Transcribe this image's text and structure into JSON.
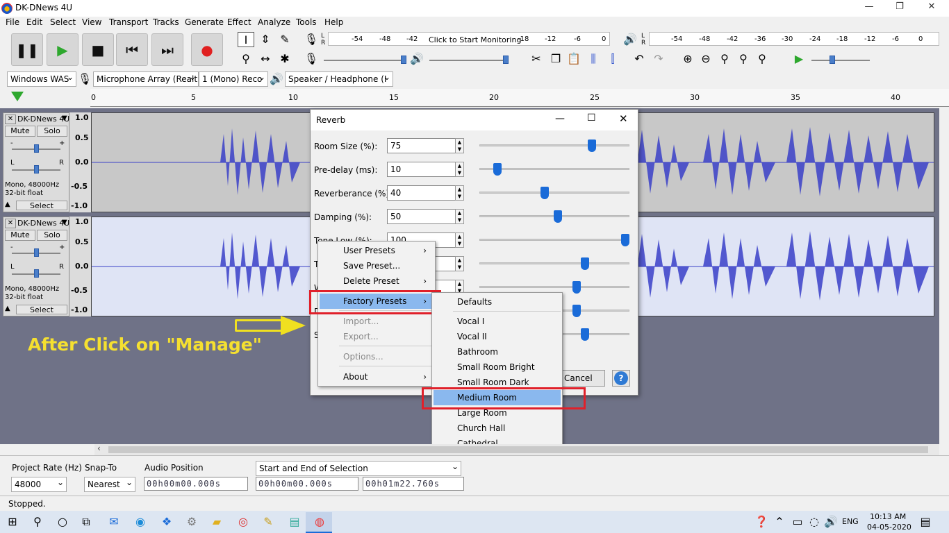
{
  "window": {
    "title": "DK-DNews 4U"
  },
  "menubar": [
    "File",
    "Edit",
    "Select",
    "View",
    "Transport",
    "Tracks",
    "Generate",
    "Effect",
    "Analyze",
    "Tools",
    "Help"
  ],
  "meters": {
    "record_ticks": [
      "-54",
      "-48",
      "-42",
      "-18",
      "-12",
      "-6",
      "0"
    ],
    "record_label": "Click to Start Monitoring",
    "play_ticks": [
      "-54",
      "-48",
      "-42",
      "-36",
      "-30",
      "-24",
      "-18",
      "-12",
      "-6",
      "0"
    ],
    "lr": [
      "L",
      "R"
    ]
  },
  "devices": {
    "host": "Windows WAS",
    "mic": "Microphone Array (Realt",
    "channels": "1 (Mono) Reco",
    "speaker": "Speaker / Headphone (I"
  },
  "ruler": [
    "0",
    "5",
    "10",
    "15",
    "20",
    "25",
    "30",
    "35",
    "40"
  ],
  "tracks": [
    {
      "name": "DK-DNews 4U",
      "mute": "Mute",
      "solo": "Solo",
      "info1": "Mono, 48000Hz",
      "info2": "32-bit float",
      "select": "Select",
      "gain_marks": [
        "-",
        "+"
      ],
      "pan_marks": [
        "L",
        "R"
      ],
      "scale": [
        "1.0",
        "0.5",
        "0.0",
        "-0.5",
        "-1.0"
      ]
    },
    {
      "name": "DK-DNews 4U",
      "mute": "Mute",
      "solo": "Solo",
      "info1": "Mono, 48000Hz",
      "info2": "32-bit float",
      "select": "Select",
      "gain_marks": [
        "-",
        "+"
      ],
      "pan_marks": [
        "L",
        "R"
      ],
      "scale": [
        "1.0",
        "0.5",
        "0.0",
        "-0.5",
        "-1.0"
      ]
    }
  ],
  "annotation": "After Click on \"Manage\"",
  "dialog": {
    "title": "Reverb",
    "params": [
      {
        "label": "Room Size (%):",
        "value": "75",
        "level": 0.75
      },
      {
        "label": "Pre-delay (ms):",
        "value": "10",
        "level": 0.05
      },
      {
        "label": "Reverberance (%):",
        "value": "40",
        "level": 0.4
      },
      {
        "label": "Damping (%):",
        "value": "50",
        "level": 0.5
      },
      {
        "label": "Tone Low (%):",
        "value": "100",
        "level": 1.0
      }
    ],
    "partial_labels": [
      "T",
      "W",
      "D",
      "S"
    ],
    "extra_levels": [
      0.7,
      0.64,
      0.64,
      0.7
    ],
    "cancel": "Cancel",
    "help": "?"
  },
  "manage_menu": [
    {
      "label": "User Presets",
      "submenu": true,
      "disabled": false
    },
    {
      "label": "Save Preset...",
      "submenu": false,
      "disabled": false
    },
    {
      "label": "Delete Preset",
      "submenu": true,
      "disabled": false
    },
    {
      "label": "Factory Presets",
      "submenu": true,
      "disabled": false,
      "highlighted": true
    },
    {
      "label": "Import...",
      "submenu": false,
      "disabled": true
    },
    {
      "label": "Export...",
      "submenu": false,
      "disabled": true
    },
    {
      "label": "Options...",
      "submenu": false,
      "disabled": true
    },
    {
      "label": "About",
      "submenu": true,
      "disabled": false
    }
  ],
  "factory_presets": [
    "Defaults",
    "Vocal I",
    "Vocal II",
    "Bathroom",
    "Small Room Bright",
    "Small Room Dark",
    "Medium Room",
    "Large Room",
    "Church Hall",
    "Cathedral"
  ],
  "selected_preset": "Medium Room",
  "selection_toolbar": {
    "project_rate_label": "Project Rate (Hz)",
    "project_rate": "48000",
    "snap_label": "Snap-To",
    "snap_value": "Nearest",
    "audio_position_label": "Audio Position",
    "selection_mode": "Start and End of Selection",
    "audio_position": "00h00m00.000s",
    "sel_start": "00h00m00.000s",
    "sel_end": "00h01m22.760s"
  },
  "status": "Stopped.",
  "taskbar": {
    "lang": "ENG",
    "time": "10:13 AM",
    "date": "04-05-2020"
  }
}
